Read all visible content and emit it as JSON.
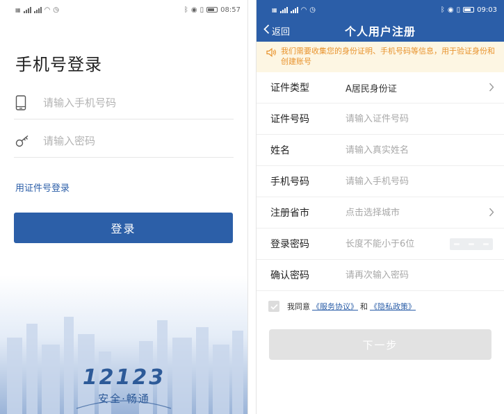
{
  "left": {
    "status": {
      "time": "08:57"
    },
    "title": "手机号登录",
    "phone_placeholder": "请输入手机号码",
    "password_placeholder": "请输入密码",
    "id_login_link": "用证件号登录",
    "login_button": "登录",
    "brand": {
      "number": "12123",
      "slogan": "安全·畅通"
    }
  },
  "right": {
    "status": {
      "time": "09:03"
    },
    "nav": {
      "back_label": "返回",
      "title": "个人用户注册"
    },
    "notice": "我们需要收集您的身份证明、手机号码等信息，用于验证身份和创建账号",
    "form": {
      "id_type": {
        "label": "证件类型",
        "value": "A居民身份证"
      },
      "id_number": {
        "label": "证件号码",
        "placeholder": "请输入证件号码"
      },
      "name": {
        "label": "姓名",
        "placeholder": "请输入真实姓名"
      },
      "phone": {
        "label": "手机号码",
        "placeholder": "请输入手机号码"
      },
      "region": {
        "label": "注册省市",
        "placeholder": "点击选择城市"
      },
      "password": {
        "label": "登录密码",
        "placeholder": "长度不能小于6位"
      },
      "confirm_password": {
        "label": "确认密码",
        "placeholder": "请再次输入密码"
      }
    },
    "agreement": {
      "prefix": "我同意",
      "service_link": "《服务协议》",
      "conjunction": "和",
      "privacy_link": "《隐私政策》"
    },
    "next_button": "下一步"
  },
  "colors": {
    "brand_blue": "#2b5ea8",
    "notice_text": "#e8922c",
    "notice_bg": "#fdf6e3",
    "disabled_button": "#e2e2e2"
  },
  "icons": [
    "phone-icon",
    "key-icon",
    "chevron-left-icon",
    "speaker-icon",
    "chevron-right-icon",
    "checkmark-icon",
    "bluetooth-icon",
    "location-icon",
    "vibrate-icon",
    "battery-icon",
    "wifi-icon",
    "alarm-icon",
    "signal-icon"
  ]
}
